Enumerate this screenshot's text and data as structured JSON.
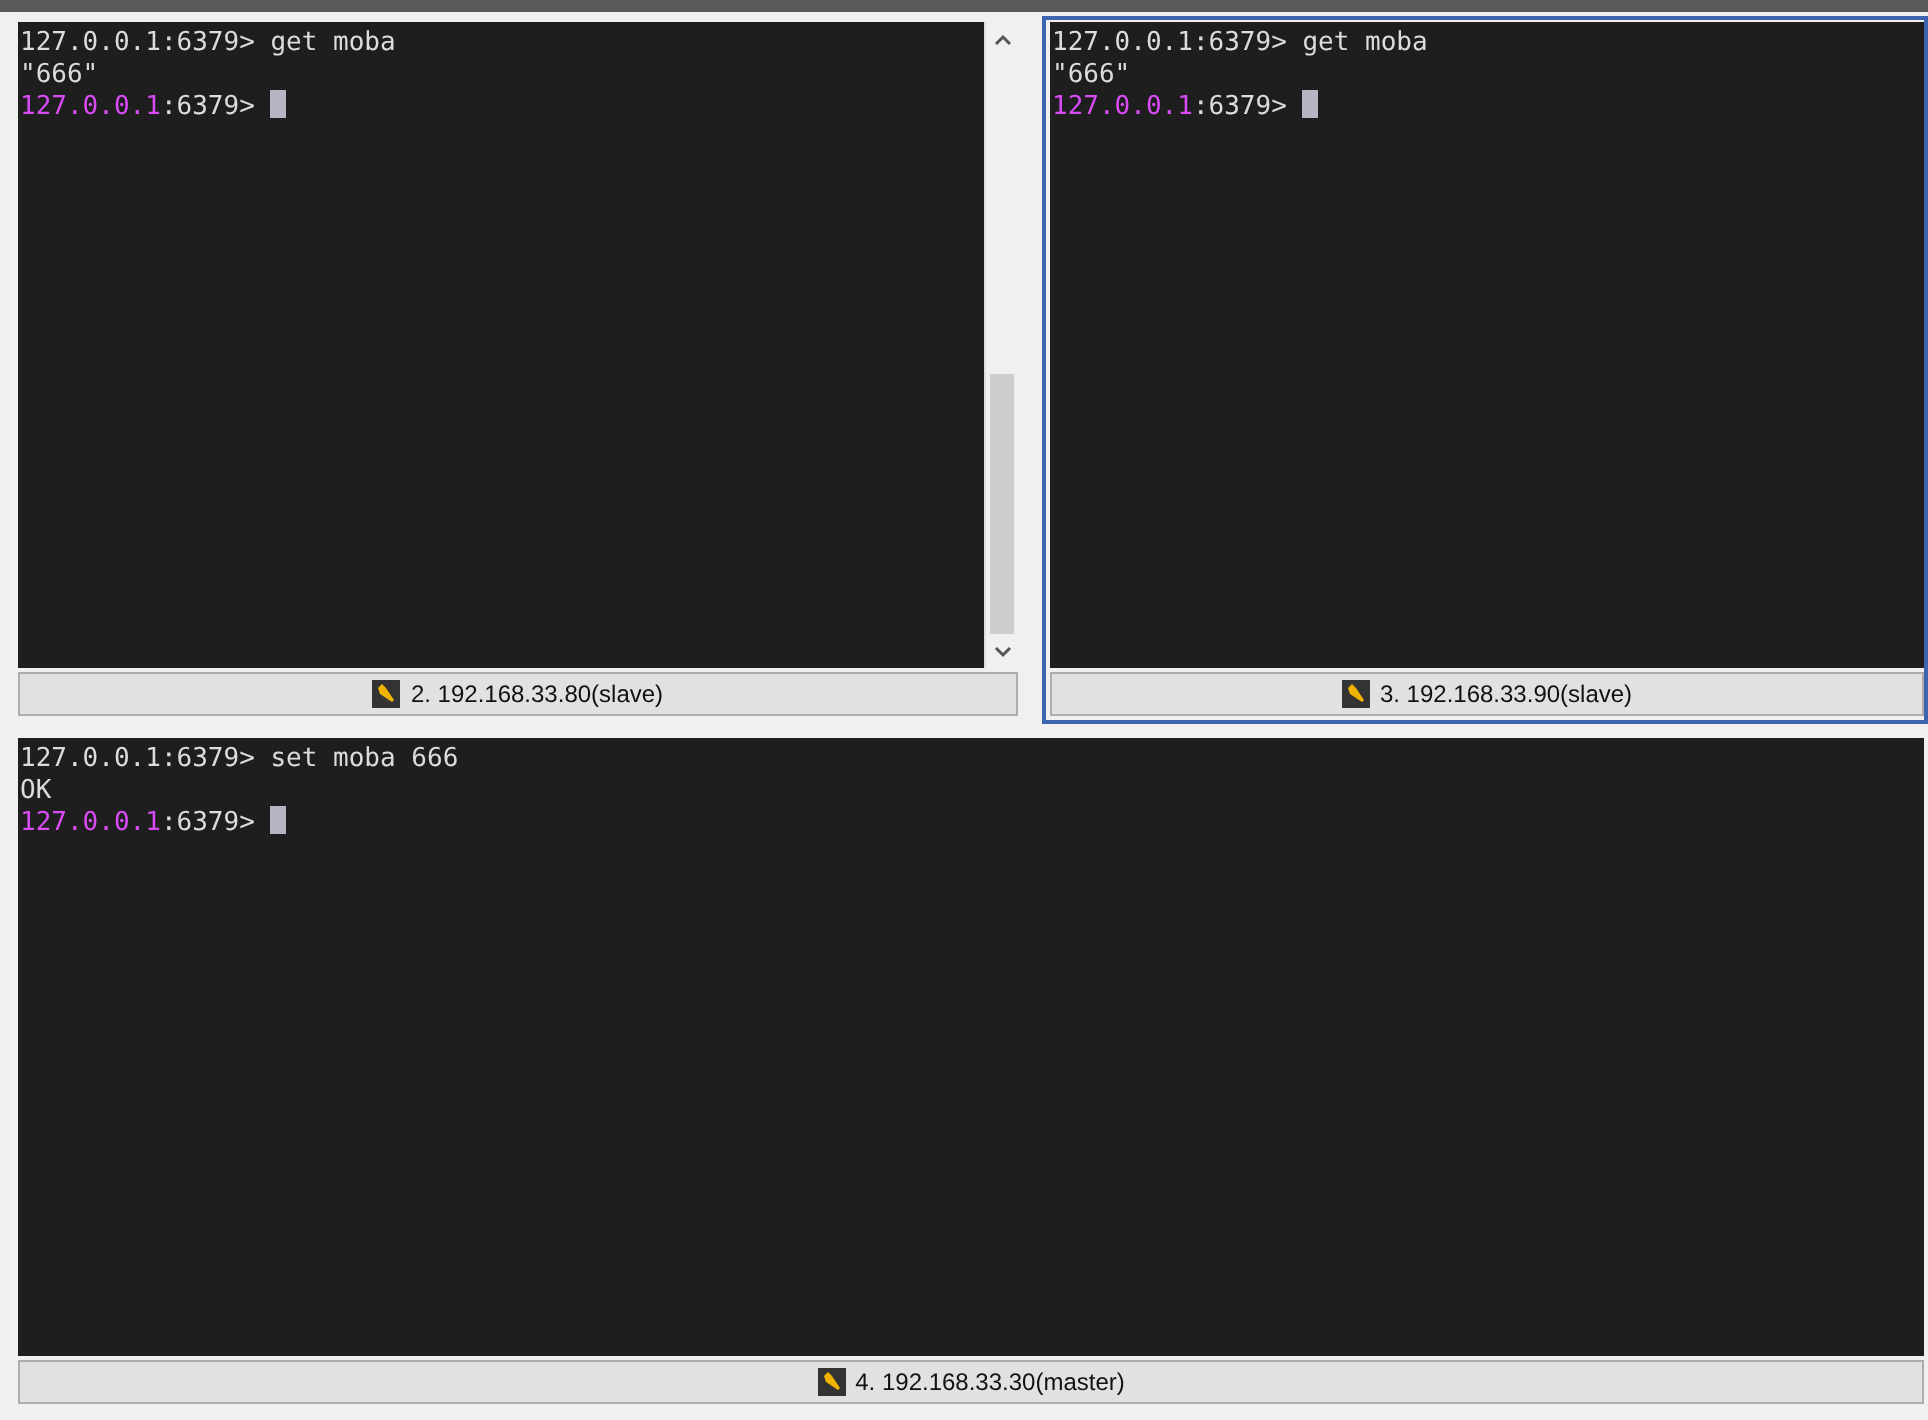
{
  "panes": [
    {
      "title": "2. 192.168.33.80(slave)",
      "selected": false,
      "scrollbar": true,
      "lines": [
        {
          "parts": [
            {
              "text": "127.0.0.1:6379> get moba",
              "kind": "plain"
            }
          ]
        },
        {
          "parts": [
            {
              "text": "\"666\"",
              "kind": "plain"
            }
          ]
        },
        {
          "parts": [
            {
              "text": "127.0.0.1",
              "kind": "host"
            },
            {
              "text": ":6379>",
              "kind": "plain"
            }
          ],
          "cursor": true
        }
      ]
    },
    {
      "title": "3. 192.168.33.90(slave)",
      "selected": true,
      "scrollbar": false,
      "lines": [
        {
          "parts": [
            {
              "text": "127.0.0.1:6379> get moba",
              "kind": "plain"
            }
          ]
        },
        {
          "parts": [
            {
              "text": "\"666\"",
              "kind": "plain"
            }
          ]
        },
        {
          "parts": [
            {
              "text": "127.0.0.1",
              "kind": "host"
            },
            {
              "text": ":6379>",
              "kind": "plain"
            }
          ],
          "cursor": true
        }
      ]
    },
    {
      "title": "4. 192.168.33.30(master)",
      "selected": false,
      "scrollbar": false,
      "lines": [
        {
          "parts": [
            {
              "text": "127.0.0.1:6379> set moba 666",
              "kind": "plain"
            }
          ]
        },
        {
          "parts": [
            {
              "text": "OK",
              "kind": "plain"
            }
          ]
        },
        {
          "parts": [
            {
              "text": "127.0.0.1",
              "kind": "host"
            },
            {
              "text": ":6379>",
              "kind": "plain"
            }
          ],
          "cursor": true
        }
      ]
    }
  ]
}
